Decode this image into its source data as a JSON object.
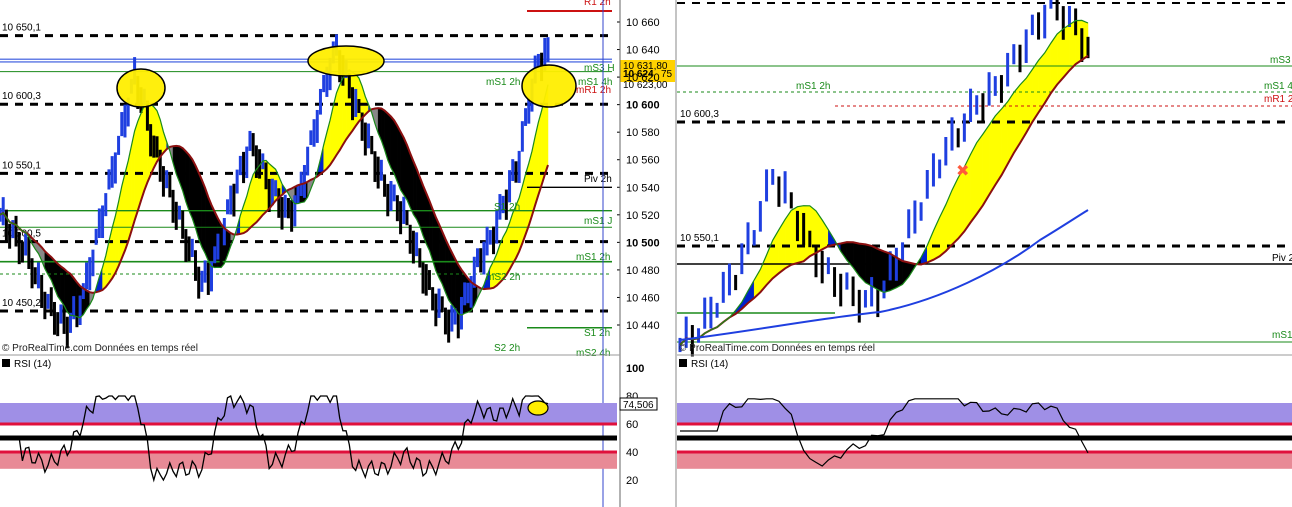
{
  "colors": {
    "bull": "#1f3fe0",
    "bear": "#000000",
    "green": "#1a8a1a",
    "red": "#cc1111",
    "cloud_yellow": "#ffff00",
    "cloud_blue": "#0022cc",
    "cloud_black": "#000000",
    "cloud_gray": "#888888",
    "rsi_band_purple": "#9f8fe6",
    "rsi_band_red": "#e88a96",
    "dotted_level": "#000000",
    "highlight": "#ffee00"
  },
  "left_chart": {
    "price_axis_ticks": [
      "10 660",
      "10 640",
      "10 620",
      "10 600",
      "10 580",
      "10 560",
      "10 540",
      "10 520",
      "10 500",
      "10 480",
      "10 460",
      "10 440"
    ],
    "bold_ticks": [
      "10 600",
      "10 500"
    ],
    "level_labels": [
      "10 650,1",
      "10 600,3",
      "10 550,1",
      "10 500,5",
      "10 450,2"
    ],
    "pivot_labels": {
      "r1": "R1 2h",
      "ms3_h": "mS3 H",
      "ms1_h": "mS1 4h",
      "mr1_2h": "mR1 2h",
      "ms1_2h": "mS1 2h",
      "piv_2h": "Piv 2h",
      "s1_2h_a": "S1 2h",
      "ms1_j": "mS1 J",
      "ms1_2h_b": "mS1 2h",
      "ms2_2h": "mS2 2h",
      "s1_2h_b": "S1 2h",
      "s2_2h": "S2 2h",
      "ms2_4h": "mS2 4h"
    },
    "price_tags": {
      "a": "10 631,80",
      "b": "10 624",
      "c": "75",
      "d": "10 623,00"
    },
    "watermark": "© ProRealTime.com Données en temps réel",
    "rsi_title": "RSI (14)",
    "rsi_ticks": [
      "100",
      "80",
      "60",
      "40",
      "20"
    ],
    "rsi_value": "74,506"
  },
  "right_chart": {
    "level_labels": [
      "10 600,3",
      "10 550,1"
    ],
    "pivot_labels": {
      "ms1_2h": "mS1 2h",
      "ms3": "mS3",
      "ms1_4": "mS1 4",
      "mr1_2": "mR1 2",
      "piv_2": "Piv 2",
      "ms1": "mS1"
    },
    "watermark": "© ProRealTime.com Données en temps réel",
    "rsi_title": "RSI (14)"
  },
  "chart_data": [
    {
      "type": "line",
      "title": "",
      "y_range": [
        10430,
        10670
      ],
      "levels": [
        10650.1,
        10600.3,
        10550.1,
        10500.5,
        10450.2
      ],
      "series": [
        {
          "values": [
            10520,
            10510,
            10500,
            10490,
            10470,
            10455,
            10445,
            10440,
            10450,
            10470,
            10500,
            10530,
            10560,
            10590,
            10620,
            10600,
            10570,
            10550,
            10530,
            10510,
            10490,
            10470,
            10480,
            10500,
            10530,
            10550,
            10570,
            10560,
            10540,
            10530,
            10520,
            10530,
            10560,
            10590,
            10620,
            10640,
            10620,
            10600,
            10580,
            10560,
            10540,
            10530,
            10520,
            10500,
            10480,
            10460,
            10450,
            10440,
            10450,
            10470,
            10490,
            10500,
            10520,
            10540,
            10560,
            10600,
            10630,
            10640
          ]
        }
      ]
    },
    {
      "type": "line",
      "title": "",
      "y_range": [
        10540,
        10660
      ],
      "levels": [
        10600.3,
        10550.1
      ],
      "series": [
        {
          "values": [
            10540,
            10545,
            10555,
            10565,
            10580,
            10600,
            10590,
            10575,
            10565,
            10560,
            10555,
            10560,
            10575,
            10590,
            10605,
            10615,
            10625,
            10630,
            10640,
            10650,
            10660,
            10655,
            10645
          ]
        }
      ]
    }
  ]
}
